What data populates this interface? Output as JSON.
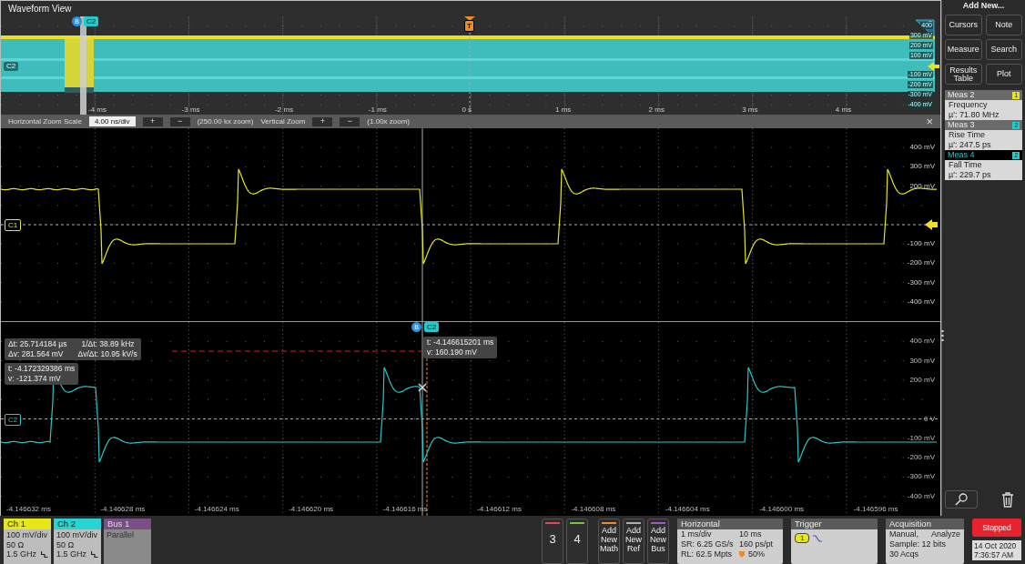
{
  "window": {
    "title": "Waveform View"
  },
  "overview": {
    "badges": [
      {
        "label": "B",
        "kind": "bus",
        "color": "#2f8fd8"
      },
      {
        "label": "C2",
        "kind": "channel",
        "color": "#27c8c8"
      }
    ],
    "trigger_marker": "T",
    "channel_label": "C2",
    "xticks": [
      "-4 ms",
      "-3 ms",
      "-2 ms",
      "-1 ms",
      "0 s",
      "1 ms",
      "2 ms",
      "3 ms",
      "4 ms"
    ],
    "yticks": [
      "400",
      "300 mV",
      "200 mV",
      "100 mV",
      "-100 mV",
      "-200 mV",
      "-300 mV",
      "-400 mV"
    ]
  },
  "zoom_bar": {
    "horizontal_label": "Horizontal Zoom Scale",
    "horizontal_value": "4.00 ns/div",
    "plus": "+",
    "minus": "−",
    "horizontal_zoom": "(250.00 kx zoom)",
    "vertical_label": "Vertical Zoom",
    "vertical_zoom": "(1.00x zoom)",
    "close": "×"
  },
  "plots": [
    {
      "label": "C1",
      "color": "#e6e619",
      "yticks": [
        "400 mV",
        "300 mV",
        "200 mV",
        "-100 mV",
        "-200 mV",
        "-300 mV",
        "-400 mV"
      ]
    },
    {
      "label": "C2",
      "color": "#27c8c8",
      "yticks": [
        "400 mV",
        "300 mV",
        "200 mV",
        "0 V",
        "-100 mV",
        "-200 mV",
        "-300 mV",
        "-400 mV"
      ],
      "badges": [
        {
          "label": "B",
          "kind": "bus",
          "color": "#2f8fd8"
        },
        {
          "label": "C2",
          "kind": "channel",
          "color": "#27c8c8"
        }
      ],
      "xticks": [
        "-4.146632 ms",
        "-4.146628 ms",
        "-4.146624 ms",
        "-4.146620 ms",
        "-4.146616 ms",
        "-4.146612 ms",
        "-4.146608 ms",
        "-4.146604 ms",
        "-4.146600 ms",
        "-4.146596 ms"
      ]
    }
  ],
  "readouts": [
    {
      "rows": [
        [
          "Δt: 25.714184 µs",
          "1/Δt: 38.89 kHz"
        ],
        [
          "Δv: 281.564 mV",
          "Δv/Δt: 10.95 kV/s"
        ]
      ]
    },
    {
      "rows": [
        [
          "t: -4.172329386 ms"
        ],
        [
          "v: -121.374 mV"
        ]
      ]
    },
    {
      "rows": [
        [
          "t: -4.146615201 ms"
        ],
        [
          "v: 160.190 mV"
        ]
      ]
    }
  ],
  "side": {
    "title": "Add New...",
    "buttons": [
      "Cursors",
      "Note",
      "Measure",
      "Search",
      "Results Table",
      "Plot"
    ],
    "measurements": [
      {
        "title": "Meas 2",
        "source": "1",
        "color": "#e6e619",
        "name": "Frequency",
        "value": "µ': 71.80 MHz",
        "selected": false
      },
      {
        "title": "Meas 3",
        "source": "2",
        "color": "#27c8c8",
        "name": "Rise Time",
        "value": "µ': 247.5 ps",
        "selected": false
      },
      {
        "title": "Meas 4",
        "source": "2",
        "color": "#27c8c8",
        "name": "Fall Time",
        "value": "µ': 229.7 ps",
        "selected": true
      }
    ]
  },
  "channels": [
    {
      "label": "Ch 1",
      "kind": "channel",
      "color": "#e6e619",
      "lines": [
        "100 mV/div",
        "50 Ω",
        "1.5 GHz"
      ]
    },
    {
      "label": "Ch 2",
      "kind": "channel",
      "color": "#27d4d4",
      "lines": [
        "100 mV/div",
        "50 Ω",
        "1.5 GHz"
      ]
    },
    {
      "label": "Bus 1",
      "kind": "bus",
      "color": "#7a4f86",
      "lines": [
        "Parallel"
      ]
    }
  ],
  "add_buttons": [
    {
      "label": "3",
      "kind": "channel",
      "color": "#e0455a"
    },
    {
      "label": "4",
      "kind": "channel",
      "color": "#7ac143"
    },
    {
      "label": "Add New Math",
      "kind": "add",
      "color": "#f08a24"
    },
    {
      "label": "Add New Ref",
      "kind": "add",
      "color": "#b0b0b0"
    },
    {
      "label": "Add New Bus",
      "kind": "add",
      "color": "#9b59c9"
    }
  ],
  "horizontal": {
    "title": "Horizontal",
    "rows": [
      [
        "1 ms/div",
        "10 ms"
      ],
      [
        "SR: 6.25 GS/s",
        "160 ps/pt"
      ],
      [
        "RL: 62.5 Mpts",
        "50%"
      ]
    ]
  },
  "trigger": {
    "title": "Trigger",
    "source": "1",
    "color": "#e6e619"
  },
  "acquisition": {
    "title": "Acquisition",
    "rows": [
      [
        "Manual,",
        "Analyze"
      ],
      [
        "Sample: 12 bits"
      ],
      [
        "30 Acqs"
      ]
    ]
  },
  "run_state": "Stopped",
  "datetime": [
    "14 Oct 2020",
    "7:36:57 AM"
  ]
}
